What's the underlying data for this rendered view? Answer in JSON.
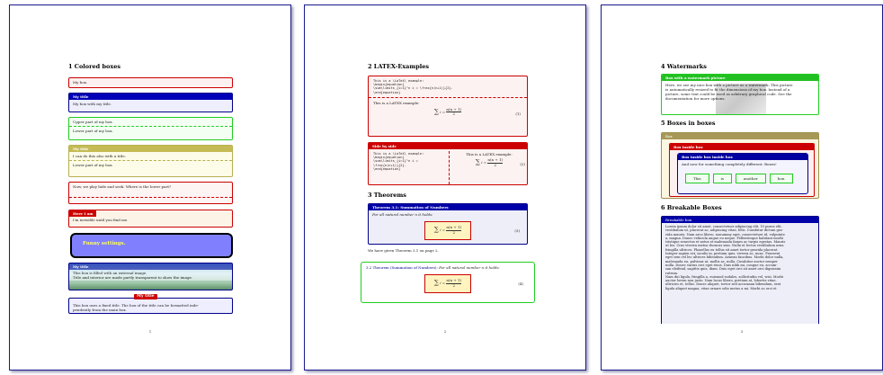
{
  "page1": {
    "section": "1   Colored boxes",
    "box1": "My box.",
    "box2_title": "My title",
    "box2_body": "My box with my title.",
    "box3_upper": "Upper part of my box.",
    "box3_lower": "Lower part of my box.",
    "box4_title": "My title",
    "box4_upper": "I can do this also with a title.",
    "box4_lower": "Lower part of my box.",
    "box5": "Now, we play hide and seek. Where is the lower part?",
    "box6_title": "Here I am",
    "box6_body": "I'm invisible until you find me.",
    "box7": "Funny settings.",
    "box8_title": "My title",
    "box8_body1": "This box is filled with an external image.",
    "box8_body2": "Title and interior are made partly transparent to show the image.",
    "box9_title": "My title",
    "box9_body1": "This box uses a fixed title. The box of the title can be formatted inde-",
    "box9_body2": "pendently from the main box.",
    "page_number": "1"
  },
  "page2": {
    "section2": "2   LATEX-Examples",
    "ex_code": [
      "This is a \\LaTeX\\ example:",
      "\\begin{equation}",
      "\\sum\\limits_{i=1}^n i = \\frac{n(n+1)}{2}.",
      "\\end{equation}"
    ],
    "ex_text": "This is a LATEX example:",
    "eq_num": "(1)",
    "side_title": "Side by side",
    "side_code": [
      "This is a \\LaTeX\\ example:",
      "\\begin{equation}",
      "\\sum\\limits_{i=1}^n i =",
      "   \\frac{n(n+1)}{2}.",
      "\\end{equation}"
    ],
    "side_text": "This is a LATEX example:",
    "side_eq_num": "(2)",
    "section3": "3   Theorems",
    "thm_title": "Theorem 3.1: Summation of Numbers",
    "thm_body": "For all natural number n it holds:",
    "thm_eq_num": "(3)",
    "ref_text": "We have given Theorem 3.1 on page 2.",
    "thm2_head": "3.2 Theorem (Summation of Numbers):",
    "thm2_body": "For all natural number n it holds:",
    "thm2_eq_num": "(4)",
    "eq_lhs": "i =",
    "eq_num_top": "n(n + 1)",
    "eq_num_bottom": "2",
    "page_number": "2"
  },
  "page3": {
    "section4": "4   Watermarks",
    "wm_title": "Box with a watermark picture",
    "wm_body": [
      "Here, we see my nice box with a picture as a watermark. This picture",
      "is automatically resized to fit the dimensions of my box. Instead of a",
      "picture, some text could be used as arbitrary graphical code. See the",
      "documentation for more options."
    ],
    "section5": "5   Boxes in boxes",
    "outer_title": "Box",
    "inner_title": "Box inside box",
    "inner2_title": "Box inside box inside box",
    "inner2_body": "And now for something completely different: Boxes!",
    "words": [
      "This",
      "is",
      "another",
      "box."
    ],
    "section6": "6   Breakable Boxes",
    "break_title": "Breakable box",
    "break_body": [
      "Lorem ipsum dolor sit amet, consectetuer adipiscing elit. Ut purus elit,",
      "vestibulum ut, placerat ac, adipiscing vitae, felis. Curabitur dictum gra-",
      "vida mauris. Nam arcu libero, nonummy eget, consectetuer id, vulputate",
      "a, magna. Donec vehicula augue eu neque. Pellentesque habitant morbi",
      "tristique senectus et netus et malesuada fames ac turpis egestas. Mauris",
      "ut leo. Cras viverra metus rhoncus sem. Nulla et lectus vestibulum urna",
      "fringilla ultrices. Phasellus eu tellus sit amet tortor gravida placerat.",
      "Integer sapien est, iaculis in, pretium quis, viverra ac, nunc. Praesent",
      "eget sem vel leo ultrices bibendum. Aenean faucibus. Morbi dolor nulla,",
      "malesuada eu, pulvinar at, mollis ac, nulla. Curabitur auctor semper",
      "nulla. Donec varius orci eget risus. Duis nibh mi, congue eu, accum-",
      "san eleifend, sagittis quis, diam. Duis eget orci sit amet orci dignissim",
      "rutrum.",
      "Nam dui ligula, fringilla a, euismod sodales, sollicitudin vel, wisi. Morbi",
      "auctor lorem non justo. Nam lacus libero, pretium at, lobortis vitae,",
      "ultricies et, tellus. Donec aliquet, tortor sed accumsan bibendum, erat",
      "ligula aliquet magna, vitae ornare odio metus a mi. Morbi ac orci et"
    ],
    "page_number": "3"
  }
}
